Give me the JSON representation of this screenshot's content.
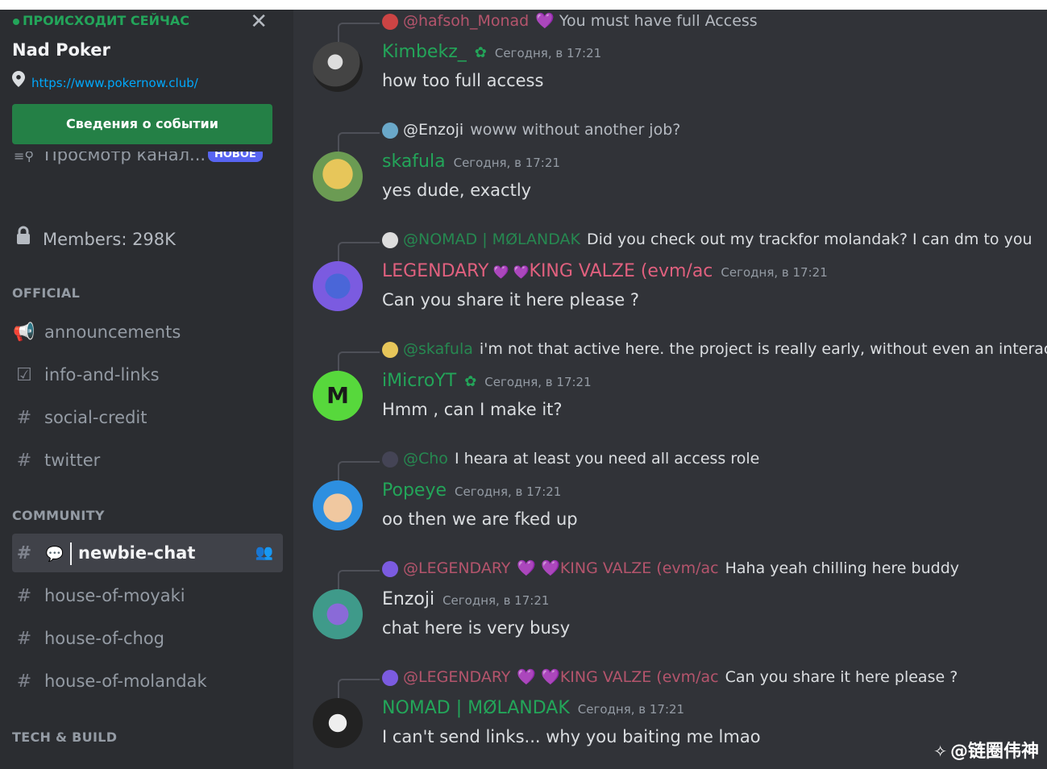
{
  "event": {
    "live_label": "ПРОИСХОДИТ СЕЙЧАС",
    "title": "Nad Poker",
    "link": "https://www.pokernow.club/",
    "details_button": "Сведения о событии"
  },
  "browse": {
    "label": "Просмотр канал...",
    "badge": "НОВОЕ"
  },
  "members": {
    "label": "Members: 298K"
  },
  "categories": {
    "official": "OFFICIAL",
    "community": "COMMUNITY",
    "tech": "TECH & BUILD"
  },
  "channels": {
    "official": [
      {
        "name": "announcements",
        "icon": "megaphone-icon"
      },
      {
        "name": "info-and-links",
        "icon": "checklist-icon"
      },
      {
        "name": "social-credit",
        "icon": "hashtag-icon"
      },
      {
        "name": "twitter",
        "icon": "hashtag-icon"
      }
    ],
    "community": [
      {
        "name": "newbie-chat",
        "icon": "hashtag-icon",
        "active": true
      },
      {
        "name": "house-of-moyaki",
        "icon": "hashtag-icon"
      },
      {
        "name": "house-of-chog",
        "icon": "hashtag-icon"
      },
      {
        "name": "house-of-molandak",
        "icon": "hashtag-icon"
      }
    ]
  },
  "messages": [
    {
      "reply": {
        "name": "@hafsoh_Monad",
        "text": "You must have full Access"
      },
      "author": "Kimbekz_",
      "author_color": "#23a559",
      "timestamp": "Сегодня, в 17:21",
      "text": "how too full access"
    },
    {
      "reply": {
        "name": "@Enzoji",
        "text": "woww without another job?"
      },
      "author": "skafula",
      "author_color": "#23a559",
      "timestamp": "Сегодня, в 17:21",
      "text": "yes dude, exactly"
    },
    {
      "reply": {
        "name": "@NOMAD | MØLANDAK",
        "text": "Did you check out my trackfor molandak? I can dm to you"
      },
      "author": "LEGENDARY",
      "author_suffix": "KING VALZE (evm/ac",
      "author_color": "#e0607e",
      "timestamp": "Сегодня, в 17:21",
      "text": "Can you share it here please ?"
    },
    {
      "reply": {
        "name": "@skafula",
        "text": "i'm not that active here. the project is really early, without even an interactiv"
      },
      "author": "iMicroYT",
      "author_color": "#23a559",
      "timestamp": "Сегодня, в 17:21",
      "text": "Hmm , can I make it?"
    },
    {
      "reply": {
        "name": "@Cho",
        "text": "I heara at least you need all access role"
      },
      "author": "Popeye",
      "author_color": "#23a559",
      "timestamp": "Сегодня, в 17:21",
      "text": "oo then we are fked up"
    },
    {
      "reply": {
        "name": "@LEGENDARY",
        "name_suffix": "KING VALZE (evm/ac",
        "text": "Haha yeah  chilling here buddy"
      },
      "author": "Enzoji",
      "author_color": "#dbdee1",
      "timestamp": "Сегодня, в 17:21",
      "text": "chat here is very busy"
    },
    {
      "reply": {
        "name": "@LEGENDARY",
        "name_suffix": "KING VALZE (evm/ac",
        "text": "Can you share it here please ?"
      },
      "author": "NOMAD | MØLANDAK",
      "author_color": "#23a559",
      "timestamp": "Сегодня, в 17:21",
      "text": "I can't send links... why you baiting me lmao"
    }
  ],
  "watermark": "@链圈伟神",
  "colors": {
    "background": "#313338",
    "sidebar": "#2b2d31",
    "green": "#23a559",
    "pink": "#e0607e",
    "link": "#00a8fc",
    "button": "#248046"
  }
}
